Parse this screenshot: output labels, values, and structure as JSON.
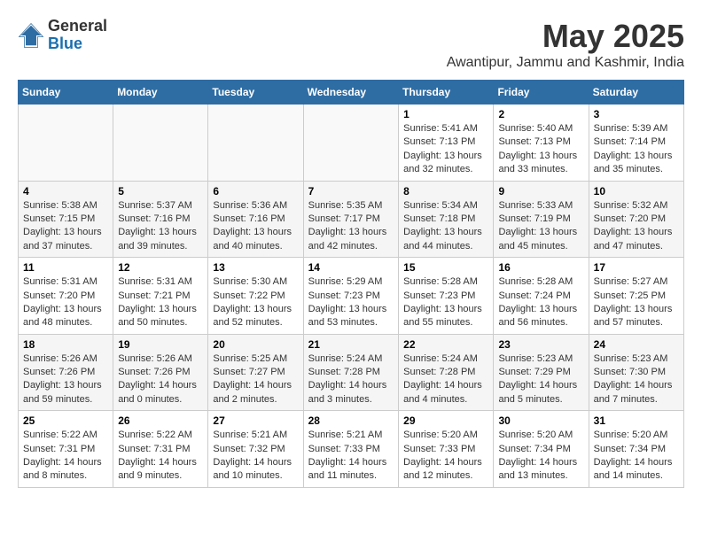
{
  "logo": {
    "general": "General",
    "blue": "Blue"
  },
  "header": {
    "month": "May 2025",
    "location": "Awantipur, Jammu and Kashmir, India"
  },
  "days_of_week": [
    "Sunday",
    "Monday",
    "Tuesday",
    "Wednesday",
    "Thursday",
    "Friday",
    "Saturday"
  ],
  "weeks": [
    [
      {
        "day": "",
        "info": ""
      },
      {
        "day": "",
        "info": ""
      },
      {
        "day": "",
        "info": ""
      },
      {
        "day": "",
        "info": ""
      },
      {
        "day": "1",
        "info": "Sunrise: 5:41 AM\nSunset: 7:13 PM\nDaylight: 13 hours\nand 32 minutes."
      },
      {
        "day": "2",
        "info": "Sunrise: 5:40 AM\nSunset: 7:13 PM\nDaylight: 13 hours\nand 33 minutes."
      },
      {
        "day": "3",
        "info": "Sunrise: 5:39 AM\nSunset: 7:14 PM\nDaylight: 13 hours\nand 35 minutes."
      }
    ],
    [
      {
        "day": "4",
        "info": "Sunrise: 5:38 AM\nSunset: 7:15 PM\nDaylight: 13 hours\nand 37 minutes."
      },
      {
        "day": "5",
        "info": "Sunrise: 5:37 AM\nSunset: 7:16 PM\nDaylight: 13 hours\nand 39 minutes."
      },
      {
        "day": "6",
        "info": "Sunrise: 5:36 AM\nSunset: 7:16 PM\nDaylight: 13 hours\nand 40 minutes."
      },
      {
        "day": "7",
        "info": "Sunrise: 5:35 AM\nSunset: 7:17 PM\nDaylight: 13 hours\nand 42 minutes."
      },
      {
        "day": "8",
        "info": "Sunrise: 5:34 AM\nSunset: 7:18 PM\nDaylight: 13 hours\nand 44 minutes."
      },
      {
        "day": "9",
        "info": "Sunrise: 5:33 AM\nSunset: 7:19 PM\nDaylight: 13 hours\nand 45 minutes."
      },
      {
        "day": "10",
        "info": "Sunrise: 5:32 AM\nSunset: 7:20 PM\nDaylight: 13 hours\nand 47 minutes."
      }
    ],
    [
      {
        "day": "11",
        "info": "Sunrise: 5:31 AM\nSunset: 7:20 PM\nDaylight: 13 hours\nand 48 minutes."
      },
      {
        "day": "12",
        "info": "Sunrise: 5:31 AM\nSunset: 7:21 PM\nDaylight: 13 hours\nand 50 minutes."
      },
      {
        "day": "13",
        "info": "Sunrise: 5:30 AM\nSunset: 7:22 PM\nDaylight: 13 hours\nand 52 minutes."
      },
      {
        "day": "14",
        "info": "Sunrise: 5:29 AM\nSunset: 7:23 PM\nDaylight: 13 hours\nand 53 minutes."
      },
      {
        "day": "15",
        "info": "Sunrise: 5:28 AM\nSunset: 7:23 PM\nDaylight: 13 hours\nand 55 minutes."
      },
      {
        "day": "16",
        "info": "Sunrise: 5:28 AM\nSunset: 7:24 PM\nDaylight: 13 hours\nand 56 minutes."
      },
      {
        "day": "17",
        "info": "Sunrise: 5:27 AM\nSunset: 7:25 PM\nDaylight: 13 hours\nand 57 minutes."
      }
    ],
    [
      {
        "day": "18",
        "info": "Sunrise: 5:26 AM\nSunset: 7:26 PM\nDaylight: 13 hours\nand 59 minutes."
      },
      {
        "day": "19",
        "info": "Sunrise: 5:26 AM\nSunset: 7:26 PM\nDaylight: 14 hours\nand 0 minutes."
      },
      {
        "day": "20",
        "info": "Sunrise: 5:25 AM\nSunset: 7:27 PM\nDaylight: 14 hours\nand 2 minutes."
      },
      {
        "day": "21",
        "info": "Sunrise: 5:24 AM\nSunset: 7:28 PM\nDaylight: 14 hours\nand 3 minutes."
      },
      {
        "day": "22",
        "info": "Sunrise: 5:24 AM\nSunset: 7:28 PM\nDaylight: 14 hours\nand 4 minutes."
      },
      {
        "day": "23",
        "info": "Sunrise: 5:23 AM\nSunset: 7:29 PM\nDaylight: 14 hours\nand 5 minutes."
      },
      {
        "day": "24",
        "info": "Sunrise: 5:23 AM\nSunset: 7:30 PM\nDaylight: 14 hours\nand 7 minutes."
      }
    ],
    [
      {
        "day": "25",
        "info": "Sunrise: 5:22 AM\nSunset: 7:31 PM\nDaylight: 14 hours\nand 8 minutes."
      },
      {
        "day": "26",
        "info": "Sunrise: 5:22 AM\nSunset: 7:31 PM\nDaylight: 14 hours\nand 9 minutes."
      },
      {
        "day": "27",
        "info": "Sunrise: 5:21 AM\nSunset: 7:32 PM\nDaylight: 14 hours\nand 10 minutes."
      },
      {
        "day": "28",
        "info": "Sunrise: 5:21 AM\nSunset: 7:33 PM\nDaylight: 14 hours\nand 11 minutes."
      },
      {
        "day": "29",
        "info": "Sunrise: 5:20 AM\nSunset: 7:33 PM\nDaylight: 14 hours\nand 12 minutes."
      },
      {
        "day": "30",
        "info": "Sunrise: 5:20 AM\nSunset: 7:34 PM\nDaylight: 14 hours\nand 13 minutes."
      },
      {
        "day": "31",
        "info": "Sunrise: 5:20 AM\nSunset: 7:34 PM\nDaylight: 14 hours\nand 14 minutes."
      }
    ]
  ]
}
